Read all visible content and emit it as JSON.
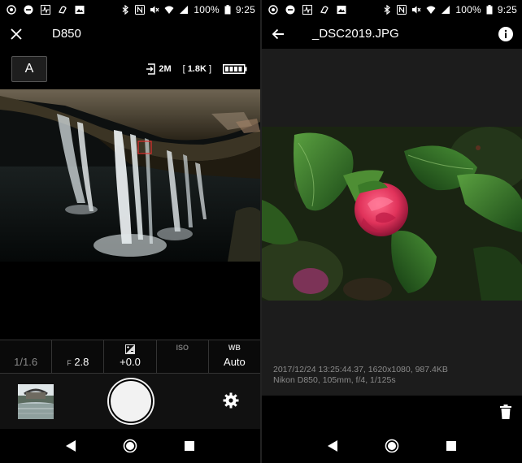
{
  "status_bar": {
    "battery": "100%",
    "time": "9:25"
  },
  "camera": {
    "title": "D850",
    "mode": "A",
    "image_size": "2M",
    "shots_remaining": "1.8K",
    "settings": {
      "shutter_value": "1/1.6",
      "aperture_label": "F",
      "aperture_value": "2.8",
      "exposure_comp_value": "+0.0",
      "iso_label": "ISO",
      "iso_value": "",
      "wb_label": "WB",
      "wb_value": "Auto"
    }
  },
  "viewer": {
    "title": "_DSC2019.JPG",
    "meta_line1": "2017/12/24 13:25:44.37, 1620x1080, 987.4KB",
    "meta_line2": "Nikon D850, 105mm, f/4, 1/125s"
  },
  "icons": {
    "close": "close-icon",
    "back": "arrow-left-icon",
    "info": "info-icon",
    "settings": "gear-icon",
    "delete": "trash-icon"
  },
  "colors": {
    "background": "#000000",
    "viewer_background": "#1c1c1c",
    "meta_text": "#8a8a8a",
    "focus_point": "#e03030",
    "rose": "#e0325a"
  }
}
